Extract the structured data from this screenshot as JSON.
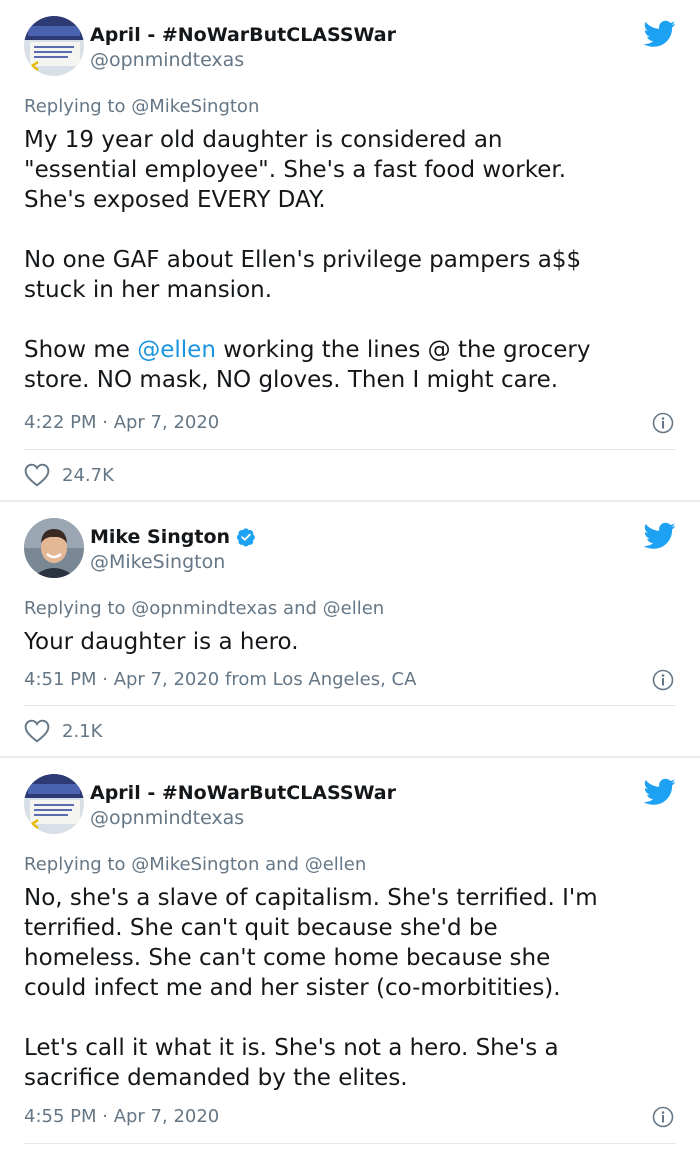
{
  "colors": {
    "link": "#1b95e0",
    "twitter_blue": "#1da1f2",
    "muted": "#657786",
    "text": "#14171a"
  },
  "tweets": [
    {
      "display_name": "April - #NoWarButCLASSWar",
      "handle": "@opnmindtexas",
      "verified": false,
      "avatar_icon": "protest-sign-avatar",
      "reply_prefix": "Replying to",
      "reply_to": "@MikeSington",
      "body": {
        "l1": "My 19 year old daughter is considered an",
        "l2": "\"essential employee\". She's a fast food worker.",
        "l3": "She's exposed EVERY DAY.",
        "l4": "No one GAF about Ellen's privilege pampers a$$",
        "l5": "stuck in her mansion.",
        "l6a": "Show me ",
        "l6_mention": "@ellen",
        "l6b": " working the lines @ the grocery",
        "l7": "store. NO mask, NO gloves. Then I might care."
      },
      "timestamp": "4:22 PM · Apr 7, 2020",
      "likes": "24.7K"
    },
    {
      "display_name": "Mike Sington",
      "handle": "@MikeSington",
      "verified": true,
      "avatar_icon": "profile-photo-avatar",
      "reply_prefix": "Replying to",
      "reply_to": "@opnmindtexas",
      "reply_and": "and",
      "reply_to_2": "@ellen",
      "body": {
        "l1": "Your daughter is a hero."
      },
      "timestamp": "4:51 PM · Apr 7, 2020 from Los Angeles, CA",
      "likes": "2.1K"
    },
    {
      "display_name": "April - #NoWarButCLASSWar",
      "handle": "@opnmindtexas",
      "verified": false,
      "avatar_icon": "protest-sign-avatar",
      "reply_prefix": "Replying to",
      "reply_to": "@MikeSington",
      "reply_and": "and",
      "reply_to_2": "@ellen",
      "body": {
        "l1": "No, she's a slave of capitalism. She's terrified. I'm",
        "l2": "terrified. She can't quit because she'd be",
        "l3": "homeless. She can't come home because she",
        "l4": "could infect me and her sister (co-morbitities).",
        "l5": "Let's call it what it is. She's not a hero. She's a",
        "l6": "sacrifice demanded by the elites."
      },
      "timestamp": "4:55 PM · Apr 7, 2020"
    }
  ]
}
